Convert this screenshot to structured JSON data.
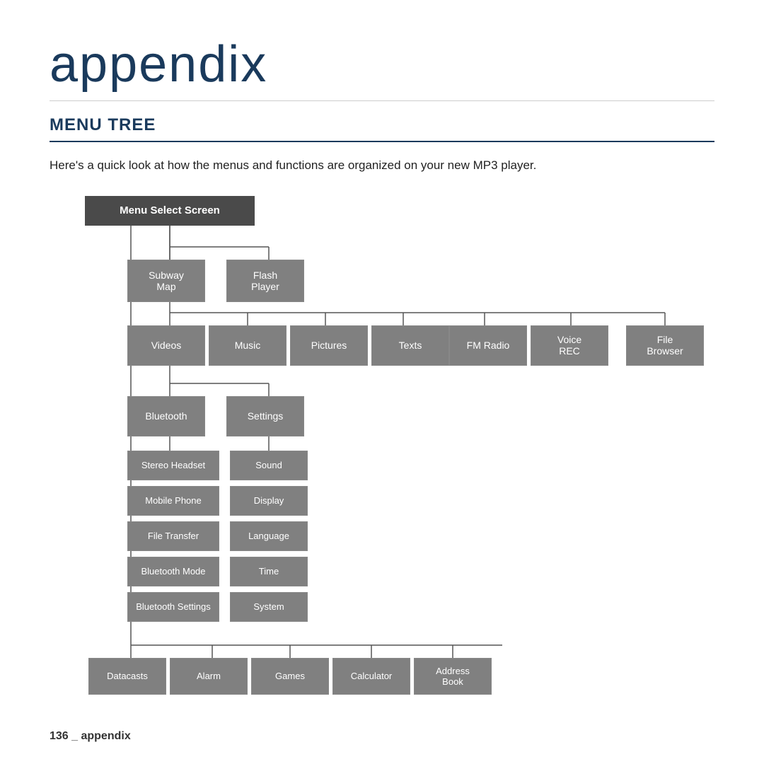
{
  "page": {
    "title": "appendix",
    "section": "MENU TREE",
    "description": "Here's a quick look at how the menus and functions are organized on your new MP3 player.",
    "footer": "136 _ appendix"
  },
  "tree": {
    "root": "Menu Select Screen",
    "row1": {
      "items": [
        "Subway\nMap",
        "Flash\nPlayer"
      ]
    },
    "row2": {
      "items": [
        "Videos",
        "Music",
        "Pictures",
        "Texts",
        "FM Radio",
        "Voice\nREC",
        "File\nBrowser"
      ]
    },
    "row3": {
      "items": [
        "Bluetooth",
        "Settings"
      ]
    },
    "bluetooth_col": [
      "Stereo Headset",
      "Mobile Phone",
      "File Transfer",
      "Bluetooth Mode",
      "Bluetooth Settings"
    ],
    "settings_col": [
      "Sound",
      "Display",
      "Language",
      "Time",
      "System"
    ],
    "row4": {
      "items": [
        "Datacasts",
        "Alarm",
        "Games",
        "Calculator",
        "Address\nBook"
      ]
    }
  }
}
